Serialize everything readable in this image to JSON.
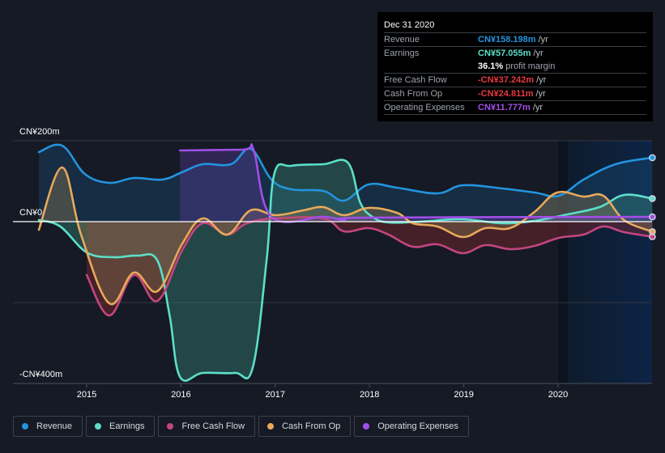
{
  "tooltip": {
    "date": "Dec 31 2020",
    "rows": [
      {
        "label": "Revenue",
        "value": "CN¥158.198m",
        "unit": "/yr",
        "color": "#2394df"
      },
      {
        "label": "Earnings",
        "value": "CN¥57.055m",
        "unit": "/yr",
        "color": "#5cdfc9"
      },
      {
        "label": "Free Cash Flow",
        "value": "-CN¥37.242m",
        "unit": "/yr",
        "color": "#e8383f"
      },
      {
        "label": "Cash From Op",
        "value": "-CN¥24.811m",
        "unit": "/yr",
        "color": "#e8383f"
      },
      {
        "label": "Operating Expenses",
        "value": "CN¥11.777m",
        "unit": "/yr",
        "color": "#a14fe8"
      }
    ],
    "profit_margin_value": "36.1%",
    "profit_margin_text": "profit margin"
  },
  "legend": [
    {
      "label": "Revenue",
      "color": "#2394df"
    },
    {
      "label": "Earnings",
      "color": "#5cdfc9"
    },
    {
      "label": "Free Cash Flow",
      "color": "#c2467f"
    },
    {
      "label": "Cash From Op",
      "color": "#e8a95b"
    },
    {
      "label": "Operating Expenses",
      "color": "#a14fe8"
    }
  ],
  "chart_data": {
    "type": "line",
    "title": "",
    "xlabel": "",
    "ylabel": "",
    "currency_unit": "CN¥ millions",
    "ylim": [
      -400,
      200
    ],
    "xlim": [
      2014.5,
      2021.0
    ],
    "y_ticks": [
      {
        "value": 200,
        "label": "CN¥200m"
      },
      {
        "value": 0,
        "label": "CN¥0"
      },
      {
        "value": -400,
        "label": "-CN¥400m"
      }
    ],
    "x_ticks": [
      {
        "value": 2015,
        "label": "2015"
      },
      {
        "value": 2016,
        "label": "2016"
      },
      {
        "value": 2017,
        "label": "2017"
      },
      {
        "value": 2018,
        "label": "2018"
      },
      {
        "value": 2019,
        "label": "2019"
      },
      {
        "value": 2020,
        "label": "2020"
      }
    ],
    "highlight_range": [
      2020.0,
      2021.0
    ],
    "grid": true,
    "series": [
      {
        "name": "Revenue",
        "color": "#2394df",
        "x": [
          2014.49,
          2014.74,
          2014.98,
          2015.24,
          2015.5,
          2015.8,
          2016.01,
          2016.23,
          2016.53,
          2016.74,
          2016.96,
          2017.17,
          2017.51,
          2017.73,
          2017.99,
          2018.29,
          2018.72,
          2018.99,
          2019.41,
          2019.75,
          2020.01,
          2020.27,
          2020.61,
          2021.0
        ],
        "values": [
          172,
          188,
          118,
          96,
          108,
          104,
          122,
          142,
          142,
          180,
          104,
          80,
          76,
          52,
          92,
          84,
          70,
          90,
          82,
          72,
          64,
          104,
          142,
          158.198
        ]
      },
      {
        "name": "Earnings",
        "color": "#5cdfc9",
        "x": [
          2014.49,
          2014.72,
          2015.0,
          2015.28,
          2015.54,
          2015.75,
          2015.88,
          2015.99,
          2016.23,
          2016.57,
          2016.76,
          2016.91,
          2016.99,
          2017.17,
          2017.51,
          2017.77,
          2017.9,
          2018.03,
          2018.2,
          2018.54,
          2018.98,
          2019.41,
          2019.75,
          2020.1,
          2020.44,
          2020.7,
          2021.0
        ],
        "values": [
          4,
          -12,
          -76,
          -88,
          -84,
          -96,
          -232,
          -384,
          -374,
          -374,
          -362,
          -92,
          118,
          138,
          142,
          146,
          48,
          12,
          -2,
          0,
          6,
          -4,
          2,
          18,
          36,
          66,
          57.055
        ]
      },
      {
        "name": "Free Cash Flow",
        "color": "#c2467f",
        "x": [
          2015.0,
          2015.24,
          2015.5,
          2015.75,
          2016.01,
          2016.23,
          2016.49,
          2016.7,
          2017.0,
          2017.51,
          2017.73,
          2017.99,
          2018.2,
          2018.46,
          2018.72,
          2018.99,
          2019.23,
          2019.49,
          2019.75,
          2020.01,
          2020.27,
          2020.48,
          2020.7,
          2021.0
        ],
        "values": [
          -132,
          -232,
          -132,
          -196,
          -72,
          -4,
          -32,
          -4,
          8,
          8,
          -24,
          -16,
          -32,
          -62,
          -56,
          -78,
          -58,
          -68,
          -60,
          -40,
          -32,
          -12,
          -26,
          -37.242
        ]
      },
      {
        "name": "Cash From Op",
        "color": "#e8a95b",
        "x": [
          2014.49,
          2014.74,
          2014.94,
          2015.24,
          2015.5,
          2015.75,
          2016.01,
          2016.23,
          2016.49,
          2016.74,
          2017.0,
          2017.3,
          2017.51,
          2017.73,
          2017.99,
          2018.29,
          2018.46,
          2018.72,
          2018.99,
          2019.23,
          2019.49,
          2019.75,
          2019.99,
          2020.27,
          2020.48,
          2020.7,
          2021.0
        ],
        "values": [
          -20,
          134,
          -32,
          -202,
          -126,
          -172,
          -56,
          8,
          -32,
          28,
          16,
          28,
          36,
          16,
          34,
          22,
          -4,
          -12,
          -38,
          -16,
          -16,
          24,
          72,
          62,
          64,
          4,
          -24.811
        ]
      },
      {
        "name": "Operating Expenses",
        "color": "#a14fe8",
        "x": [
          2015.99,
          2016.66,
          2016.77,
          2016.96,
          2017.51,
          2017.73,
          2017.99,
          2021.0
        ],
        "values": [
          176,
          178,
          178,
          12,
          12,
          4,
          10,
          11.777
        ]
      }
    ]
  }
}
